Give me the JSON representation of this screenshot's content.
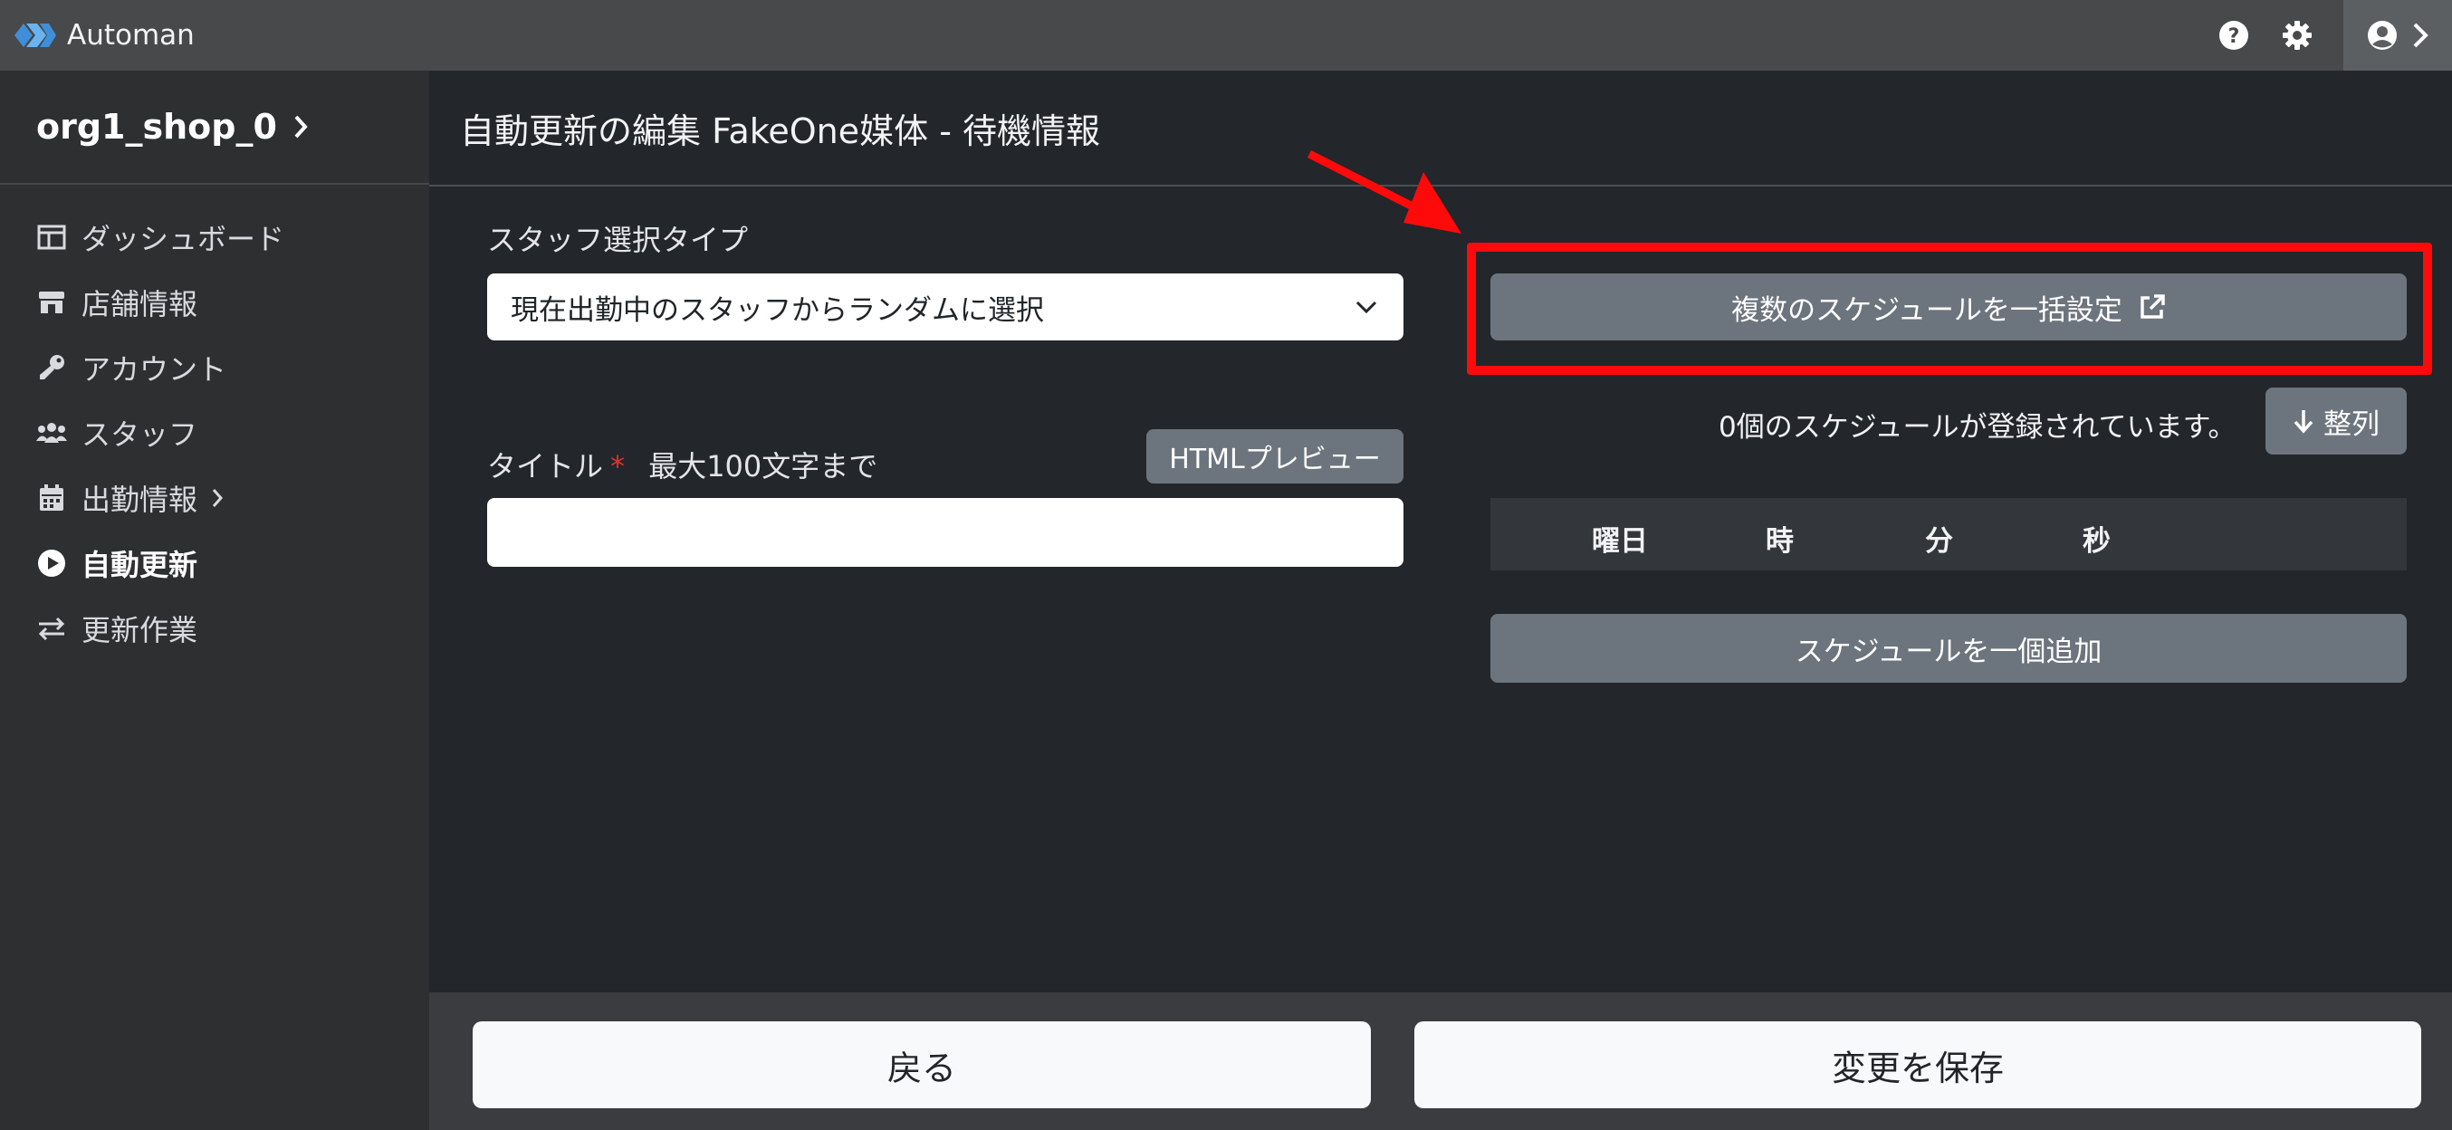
{
  "app": {
    "name": "Automan"
  },
  "sidebar": {
    "shop": "org1_shop_0",
    "items": [
      {
        "label": "ダッシュボード",
        "icon": "dashboard-icon"
      },
      {
        "label": "店舗情報",
        "icon": "store-icon"
      },
      {
        "label": "アカウント",
        "icon": "key-icon"
      },
      {
        "label": "スタッフ",
        "icon": "users-icon"
      },
      {
        "label": "出勤情報",
        "icon": "calendar-icon"
      },
      {
        "label": "自動更新",
        "icon": "play-circle-icon"
      },
      {
        "label": "更新作業",
        "icon": "exchange-icon"
      }
    ]
  },
  "page": {
    "title": "自動更新の編集 FakeOne媒体 - 待機情報"
  },
  "form": {
    "staff_type_label": "スタッフ選択タイプ",
    "staff_type_value": "現在出勤中のスタッフからランダムに選択",
    "title_label": "タイトル",
    "title_required": "*",
    "title_hint": "最大100文字まで",
    "html_preview": "HTMLプレビュー",
    "title_value": ""
  },
  "schedule": {
    "bulk_button": "複数のスケジュールを一括設定",
    "count_text": "0個のスケジュールが登録されています。",
    "sort_button": "整列",
    "columns": [
      "曜日",
      "時",
      "分",
      "秒"
    ],
    "add_button": "スケジュールを一個追加"
  },
  "footer": {
    "back": "戻る",
    "save": "変更を保存"
  },
  "colors": {
    "highlight": "#ff0a0a",
    "button": "#6c757d"
  }
}
